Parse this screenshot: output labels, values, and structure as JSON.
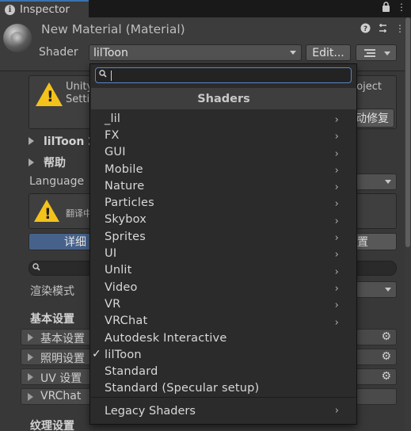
{
  "window": {
    "tab_title": "Inspector"
  },
  "header": {
    "material_title": "New Material (Material)",
    "shader_label": "Shader",
    "shader_value": "lilToon",
    "edit_button": "Edit..."
  },
  "background": {
    "warning_line1_left": "Unity",
    "warning_line2_left": "Setti",
    "warning_line1_right": "oject",
    "fix_button": "动修复",
    "foldout_liltoon": "lilToon 2",
    "foldout_help": "帮助",
    "language_label": "Language",
    "warning2_text": "翻译中",
    "detail_button": "详细",
    "settings_button": "置",
    "render_mode_label": "渲染模式",
    "basic_settings_title": "基本设置",
    "texture_settings_title": "纹理设置",
    "rows": [
      {
        "label": "基本设置"
      },
      {
        "label": "照明设置"
      },
      {
        "label": "UV 设置"
      },
      {
        "label": "VRChat"
      }
    ]
  },
  "popup": {
    "search_value": "",
    "header": "Shaders",
    "items": [
      {
        "label": "_lil",
        "submenu": true
      },
      {
        "label": "FX",
        "submenu": true
      },
      {
        "label": "GUI",
        "submenu": true
      },
      {
        "label": "Mobile",
        "submenu": true
      },
      {
        "label": "Nature",
        "submenu": true
      },
      {
        "label": "Particles",
        "submenu": true
      },
      {
        "label": "Skybox",
        "submenu": true
      },
      {
        "label": "Sprites",
        "submenu": true
      },
      {
        "label": "UI",
        "submenu": true
      },
      {
        "label": "Unlit",
        "submenu": true
      },
      {
        "label": "Video",
        "submenu": true
      },
      {
        "label": "VR",
        "submenu": true
      },
      {
        "label": "VRChat",
        "submenu": true
      },
      {
        "label": "Autodesk Interactive",
        "submenu": false
      },
      {
        "label": "lilToon",
        "submenu": false,
        "checked": true
      },
      {
        "label": "Standard",
        "submenu": false
      },
      {
        "label": "Standard (Specular setup)",
        "submenu": false
      }
    ],
    "legacy_label": "Legacy Shaders"
  },
  "icons": {
    "chevron": "›",
    "check": "✓",
    "gear": "⚙",
    "lock": "🔒",
    "help": "?",
    "kebab": "⋮"
  },
  "colors": {
    "accent_blue": "#5a86c4",
    "detail_button_bg": "#47628a",
    "warning_yellow": "#f3c21b"
  }
}
